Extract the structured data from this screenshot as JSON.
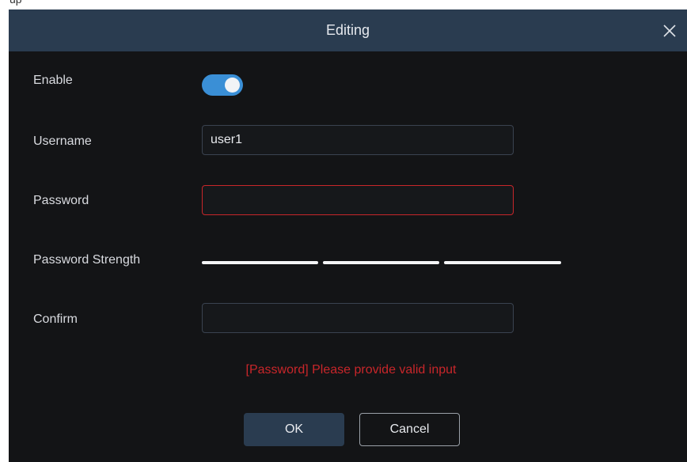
{
  "background": {
    "peek_text": "up"
  },
  "dialog": {
    "title": "Editing",
    "close_icon": "close-icon",
    "colors": {
      "titlebar": "#2a3c50",
      "body": "#131416",
      "accent": "#3a8fd6",
      "error": "#c8262a"
    }
  },
  "form": {
    "enable": {
      "label": "Enable",
      "value": true
    },
    "username": {
      "label": "Username",
      "value": "user1"
    },
    "password": {
      "label": "Password",
      "value": "",
      "state": "error"
    },
    "password_strength": {
      "label": "Password Strength",
      "segments": 3,
      "filled_segments": 0
    },
    "confirm": {
      "label": "Confirm",
      "value": ""
    }
  },
  "error_message": "[Password] Please provide valid input",
  "buttons": {
    "ok": "OK",
    "cancel": "Cancel"
  }
}
